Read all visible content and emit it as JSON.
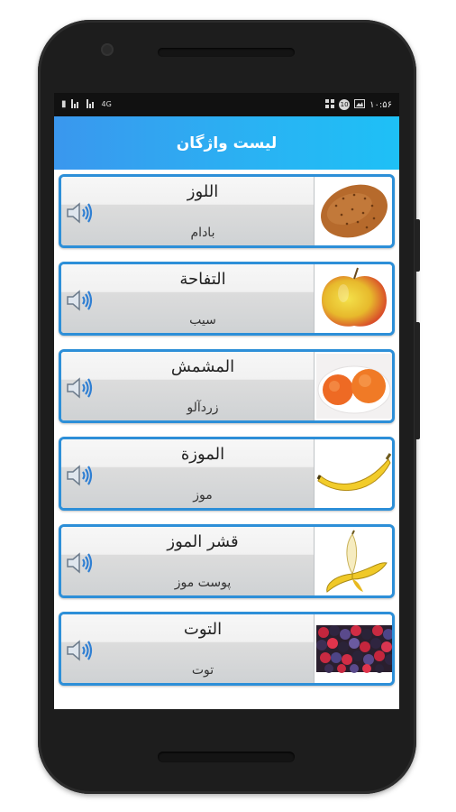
{
  "status_bar": {
    "signal_label": "4G",
    "badge": "10",
    "time": "۱۰:۵۶"
  },
  "app_bar": {
    "title": "لیست واژگان"
  },
  "items": [
    {
      "word": "اللوز",
      "translation": "بادام",
      "image": "almond"
    },
    {
      "word": "التفاحة",
      "translation": "سیب",
      "image": "apple"
    },
    {
      "word": "المشمش",
      "translation": "زردآلو",
      "image": "apricot"
    },
    {
      "word": "الموزة",
      "translation": "موز",
      "image": "banana"
    },
    {
      "word": "قشر الموز",
      "translation": "پوست موز",
      "image": "banana-peel"
    },
    {
      "word": "التوت",
      "translation": "توت",
      "image": "berries"
    }
  ],
  "colors": {
    "accent": "#2d8fd8",
    "appbar_start": "#3a97ee",
    "appbar_end": "#1ec0f6"
  }
}
